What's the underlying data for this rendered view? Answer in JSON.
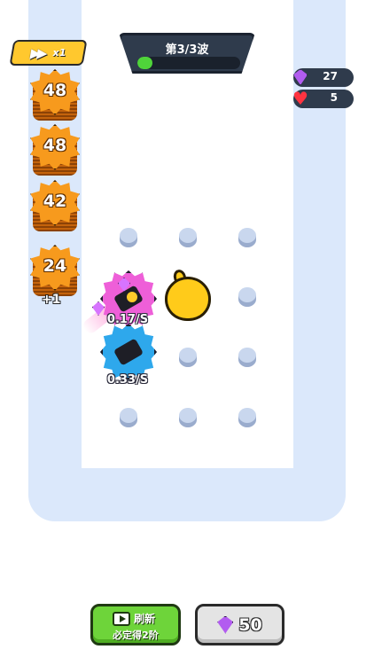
{
  "wave": {
    "label": "第3/3波",
    "progress": 0.15
  },
  "speed": {
    "label": "x1",
    "icon": "fast-forward-icon"
  },
  "resources": {
    "gems": "27",
    "lives": "5"
  },
  "enemies": [
    {
      "hp": "48"
    },
    {
      "hp": "48"
    },
    {
      "hp": "42"
    },
    {
      "hp": "24"
    }
  ],
  "plus_label": "+1",
  "towers": [
    {
      "rate": "0.17/S",
      "color": "#ee5fd8"
    },
    {
      "rate": "0.33/S",
      "color": "#2ea8ec"
    }
  ],
  "buttons": {
    "refresh_label": "刷新",
    "refresh_sub": "必定得2阶",
    "buy_price": "50"
  },
  "colors": {
    "track": "#dbe8fb",
    "banner": "#2f3b4c",
    "accent_green": "#6ed43a",
    "gold": "#ffc82e"
  }
}
